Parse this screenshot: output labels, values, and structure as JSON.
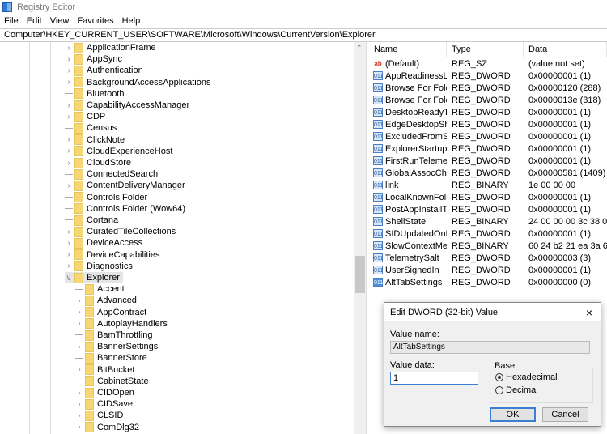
{
  "window": {
    "title": "Registry Editor"
  },
  "menu": [
    "File",
    "Edit",
    "View",
    "Favorites",
    "Help"
  ],
  "address": "Computer\\HKEY_CURRENT_USER\\SOFTWARE\\Microsoft\\Windows\\CurrentVersion\\Explorer",
  "tree": {
    "items": [
      {
        "label": "ApplicationFrame",
        "expandable": true,
        "level": 1
      },
      {
        "label": "AppSync",
        "expandable": true,
        "level": 1
      },
      {
        "label": "Authentication",
        "expandable": true,
        "level": 1
      },
      {
        "label": "BackgroundAccessApplications",
        "expandable": true,
        "level": 1
      },
      {
        "label": "Bluetooth",
        "expandable": false,
        "level": 1
      },
      {
        "label": "CapabilityAccessManager",
        "expandable": true,
        "level": 1
      },
      {
        "label": "CDP",
        "expandable": true,
        "level": 1
      },
      {
        "label": "Census",
        "expandable": false,
        "level": 1
      },
      {
        "label": "ClickNote",
        "expandable": true,
        "level": 1
      },
      {
        "label": "CloudExperienceHost",
        "expandable": true,
        "level": 1
      },
      {
        "label": "CloudStore",
        "expandable": true,
        "level": 1
      },
      {
        "label": "ConnectedSearch",
        "expandable": false,
        "level": 1
      },
      {
        "label": "ContentDeliveryManager",
        "expandable": true,
        "level": 1
      },
      {
        "label": "Controls Folder",
        "expandable": false,
        "level": 1
      },
      {
        "label": "Controls Folder (Wow64)",
        "expandable": false,
        "level": 1
      },
      {
        "label": "Cortana",
        "expandable": false,
        "level": 1
      },
      {
        "label": "CuratedTileCollections",
        "expandable": true,
        "level": 1
      },
      {
        "label": "DeviceAccess",
        "expandable": true,
        "level": 1
      },
      {
        "label": "DeviceCapabilities",
        "expandable": true,
        "level": 1
      },
      {
        "label": "Diagnostics",
        "expandable": true,
        "level": 1
      },
      {
        "label": "Explorer",
        "expandable": true,
        "expanded": true,
        "selected": true,
        "level": 1
      },
      {
        "label": "Accent",
        "expandable": false,
        "level": 2
      },
      {
        "label": "Advanced",
        "expandable": true,
        "level": 2
      },
      {
        "label": "AppContract",
        "expandable": true,
        "level": 2
      },
      {
        "label": "AutoplayHandlers",
        "expandable": true,
        "level": 2
      },
      {
        "label": "BamThrottling",
        "expandable": false,
        "level": 2
      },
      {
        "label": "BannerSettings",
        "expandable": true,
        "level": 2
      },
      {
        "label": "BannerStore",
        "expandable": false,
        "level": 2
      },
      {
        "label": "BitBucket",
        "expandable": true,
        "level": 2
      },
      {
        "label": "CabinetState",
        "expandable": false,
        "level": 2
      },
      {
        "label": "CIDOpen",
        "expandable": true,
        "level": 2
      },
      {
        "label": "CIDSave",
        "expandable": true,
        "level": 2
      },
      {
        "label": "CLSID",
        "expandable": true,
        "level": 2
      },
      {
        "label": "ComDlg32",
        "expandable": true,
        "level": 2
      }
    ]
  },
  "values": {
    "headers": [
      "Name",
      "Type",
      "Data"
    ],
    "rows": [
      {
        "name": "(Default)",
        "type": "REG_SZ",
        "data": "(value not set)",
        "icon": "string"
      },
      {
        "name": "AppReadinessLo...",
        "type": "REG_DWORD",
        "data": "0x00000001 (1)",
        "icon": "binary"
      },
      {
        "name": "Browse For Fold...",
        "type": "REG_DWORD",
        "data": "0x00000120 (288)",
        "icon": "binary"
      },
      {
        "name": "Browse For Fold...",
        "type": "REG_DWORD",
        "data": "0x0000013e (318)",
        "icon": "binary"
      },
      {
        "name": "DesktopReadyTi...",
        "type": "REG_DWORD",
        "data": "0x00000001 (1)",
        "icon": "binary"
      },
      {
        "name": "EdgeDesktopSh...",
        "type": "REG_DWORD",
        "data": "0x00000001 (1)",
        "icon": "binary"
      },
      {
        "name": "ExcludedFromSt...",
        "type": "REG_DWORD",
        "data": "0x00000001 (1)",
        "icon": "binary"
      },
      {
        "name": "ExplorerStartupT...",
        "type": "REG_DWORD",
        "data": "0x00000001 (1)",
        "icon": "binary"
      },
      {
        "name": "FirstRunTelemet...",
        "type": "REG_DWORD",
        "data": "0x00000001 (1)",
        "icon": "binary"
      },
      {
        "name": "GlobalAssocCha...",
        "type": "REG_DWORD",
        "data": "0x00000581 (1409)",
        "icon": "binary"
      },
      {
        "name": "link",
        "type": "REG_BINARY",
        "data": "1e 00 00 00",
        "icon": "binary"
      },
      {
        "name": "LocalKnownFol...",
        "type": "REG_DWORD",
        "data": "0x00000001 (1)",
        "icon": "binary"
      },
      {
        "name": "PostAppInstallTa...",
        "type": "REG_DWORD",
        "data": "0x00000001 (1)",
        "icon": "binary"
      },
      {
        "name": "ShellState",
        "type": "REG_BINARY",
        "data": "24 00 00 00 3c 38 00 00 0",
        "icon": "binary"
      },
      {
        "name": "SIDUpdatedOnLi...",
        "type": "REG_DWORD",
        "data": "0x00000001 (1)",
        "icon": "binary"
      },
      {
        "name": "SlowContextMe...",
        "type": "REG_BINARY",
        "data": "60 24 b2 21 ea 3a 69 10 a",
        "icon": "binary"
      },
      {
        "name": "TelemetrySalt",
        "type": "REG_DWORD",
        "data": "0x00000003 (3)",
        "icon": "binary"
      },
      {
        "name": "UserSignedIn",
        "type": "REG_DWORD",
        "data": "0x00000001 (1)",
        "icon": "binary"
      },
      {
        "name": "AltTabSettings",
        "type": "REG_DWORD",
        "data": "0x00000000 (0)",
        "icon": "binary",
        "highlight": true
      }
    ]
  },
  "dialog": {
    "title": "Edit DWORD (32-bit) Value",
    "value_name_label": "Value name:",
    "value_name": "AltTabSettings",
    "value_data_label": "Value data:",
    "value_data": "1",
    "base_label": "Base",
    "hex_label": "Hexadecimal",
    "dec_label": "Decimal",
    "base_selected": "Hexadecimal",
    "ok": "OK",
    "cancel": "Cancel",
    "close_icon": "×"
  }
}
